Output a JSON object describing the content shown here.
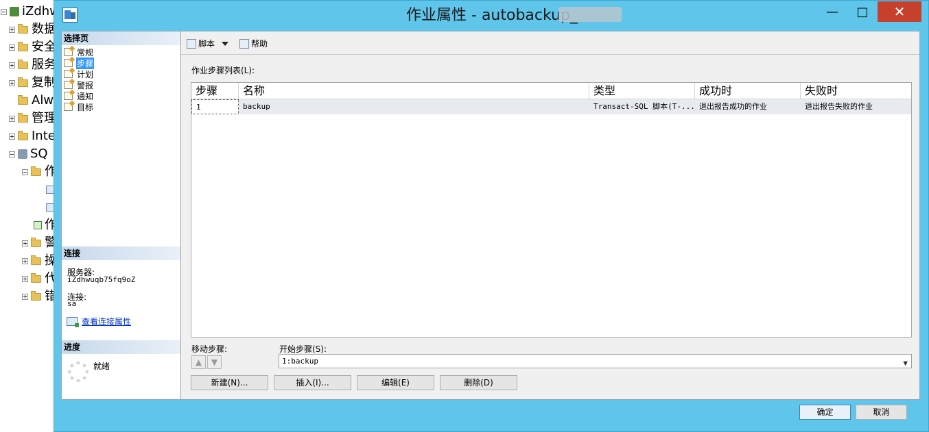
{
  "tree": {
    "root": "iZdhw",
    "nodes": [
      "数据",
      "安全",
      "服务",
      "复制",
      "Alw",
      "管理",
      "Inte",
      "SQ",
      "作",
      "",
      "",
      "作",
      "警",
      "操",
      "代",
      "错"
    ]
  },
  "window": {
    "title": "作业属性 - autobackup_",
    "minimize": "—",
    "maximize": "□",
    "close": "✕"
  },
  "left_panel": {
    "select_page_header": "选择页",
    "pages": [
      {
        "label": "常规",
        "selected": false
      },
      {
        "label": "步骤",
        "selected": true
      },
      {
        "label": "计划",
        "selected": false
      },
      {
        "label": "警报",
        "selected": false
      },
      {
        "label": "通知",
        "selected": false
      },
      {
        "label": "目标",
        "selected": false
      }
    ],
    "connection_header": "连接",
    "server_label": "服务器:",
    "server_value": "iZdhwuqb75fq9oZ",
    "connection_label": "连接:",
    "connection_value": "sa",
    "view_connection_link": "查看连接属性",
    "progress_header": "进度",
    "progress_status": "就绪"
  },
  "toolbar": {
    "script_label": "脚本",
    "help_label": "帮助"
  },
  "steps": {
    "list_caption": "作业步骤列表(L):",
    "columns": [
      "步骤",
      "名称",
      "类型",
      "成功时",
      "失败时"
    ],
    "rows": [
      {
        "step": "1",
        "name": "backup",
        "type": "Transact-SQL 脚本(T-...",
        "on_success": "退出报告成功的作业",
        "on_failure": "退出报告失败的作业"
      }
    ],
    "move_step_label": "移动步骤:",
    "start_step_label": "开始步骤(S):",
    "start_step_value": "1:backup",
    "buttons": {
      "new": "新建(N)...",
      "insert": "插入(I)...",
      "edit": "编辑(E)",
      "delete": "删除(D)"
    }
  },
  "dialog_buttons": {
    "ok": "确定",
    "cancel": "取消"
  },
  "colors": {
    "title_bar": "#5fc5ea",
    "close_button": "#c7402c",
    "selected_page": "#3399ff",
    "link": "#0033cc"
  }
}
